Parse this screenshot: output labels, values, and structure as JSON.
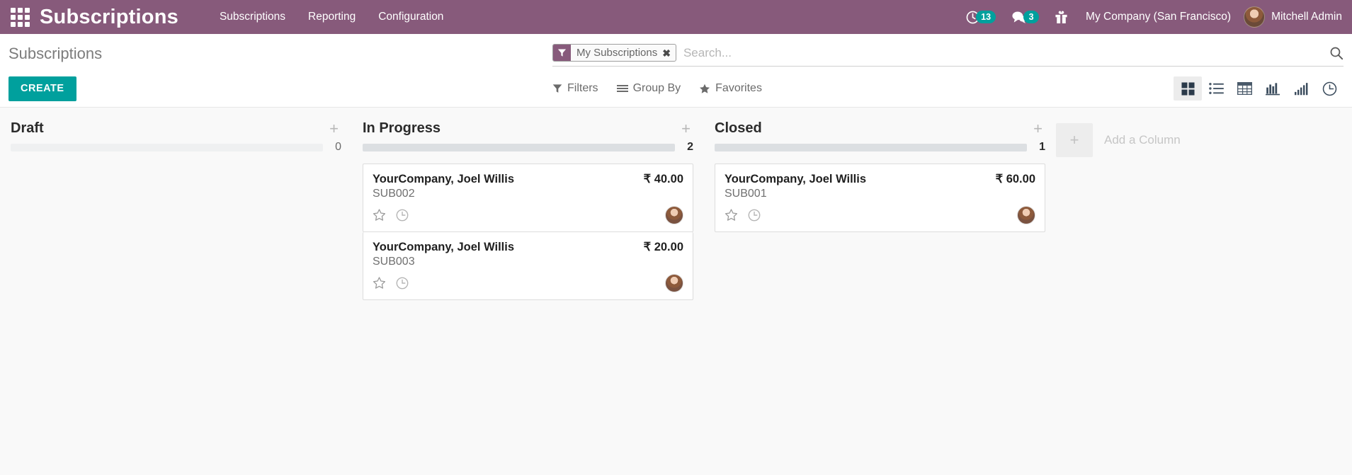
{
  "navbar": {
    "apps_icon": "apps-grid-icon",
    "brand": "Subscriptions",
    "menu": [
      {
        "label": "Subscriptions"
      },
      {
        "label": "Reporting"
      },
      {
        "label": "Configuration"
      }
    ],
    "systray": {
      "activity_icon": "clock-activity-icon",
      "activity_count": "13",
      "messaging_icon": "chat-bubble-icon",
      "messaging_count": "3",
      "gift_icon": "gift-icon"
    },
    "company": "My Company (San Francisco)",
    "user": "Mitchell Admin",
    "avatar_icon": "user-avatar",
    "accent_color": "#875A7B",
    "badge_color": "#00A09D"
  },
  "control_panel": {
    "breadcrumb": "Subscriptions",
    "create_label": "CREATE",
    "create_color": "#00A09D",
    "search": {
      "facet_icon": "filter-funnel-icon",
      "facet_label": "My Subscriptions",
      "facet_close_icon": "close-x-icon",
      "placeholder": "Search...",
      "value": "",
      "search_icon": "search-icon"
    },
    "filter_menus": [
      {
        "label": "Filters",
        "icon": "filter-funnel-icon"
      },
      {
        "label": "Group By",
        "icon": "group-by-lines-icon"
      },
      {
        "label": "Favorites",
        "icon": "star-icon"
      }
    ],
    "views": [
      {
        "name": "kanban",
        "icon": "kanban-view-icon",
        "active": true
      },
      {
        "name": "list",
        "icon": "list-view-icon",
        "active": false
      },
      {
        "name": "pivot",
        "icon": "pivot-view-icon",
        "active": false
      },
      {
        "name": "graph",
        "icon": "bar-chart-view-icon",
        "active": false
      },
      {
        "name": "cohort",
        "icon": "ascending-bars-view-icon",
        "active": false
      },
      {
        "name": "dashboard",
        "icon": "clock-view-icon",
        "active": false
      }
    ]
  },
  "kanban": {
    "columns": [
      {
        "title": "Draft",
        "count": "0",
        "progress_state": "zero",
        "cards": []
      },
      {
        "title": "In Progress",
        "count": "2",
        "progress_state": "filled",
        "cards": [
          {
            "name": "YourCompany, Joel Willis",
            "amount": "₹ 40.00",
            "code": "SUB002",
            "star_icon": "star-outline-icon",
            "activity_icon": "clock-icon",
            "avatar_icon": "user-avatar"
          },
          {
            "name": "YourCompany, Joel Willis",
            "amount": "₹ 20.00",
            "code": "SUB003",
            "star_icon": "star-outline-icon",
            "activity_icon": "clock-icon",
            "avatar_icon": "user-avatar"
          }
        ]
      },
      {
        "title": "Closed",
        "count": "1",
        "progress_state": "filled",
        "cards": [
          {
            "name": "YourCompany, Joel Willis",
            "amount": "₹ 60.00",
            "code": "SUB001",
            "star_icon": "star-outline-icon",
            "activity_icon": "clock-icon",
            "avatar_icon": "user-avatar"
          }
        ]
      }
    ],
    "add_column": {
      "plus_icon": "plus-icon",
      "label": "Add a Column"
    }
  }
}
